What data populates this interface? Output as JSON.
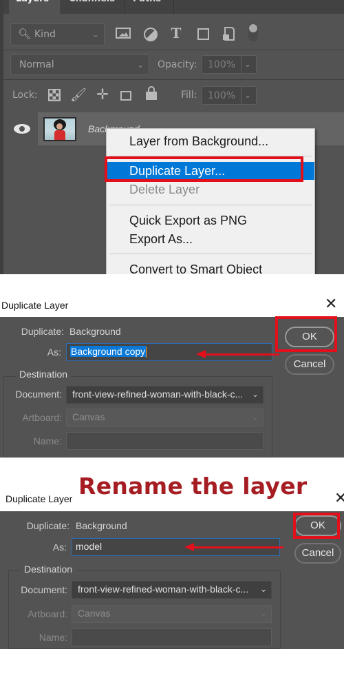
{
  "layers_panel": {
    "tabs": [
      "Layers",
      "Channels",
      "Paths"
    ],
    "filter": {
      "icon": "search-icon",
      "label": "Kind"
    },
    "filter_icons": [
      "image-filter-icon",
      "adjustment-filter-icon",
      "type-filter-icon",
      "shape-filter-icon",
      "smart-object-filter-icon",
      "filter-toggle-icon"
    ],
    "blend_mode": "Normal",
    "opacity_label": "Opacity:",
    "opacity_value": "100%",
    "lock_label": "Lock:",
    "lock_icons": [
      "lock-transparent-pixels-icon",
      "lock-image-pixels-icon",
      "lock-position-icon",
      "lock-artboard-icon",
      "lock-all-icon"
    ],
    "fill_label": "Fill:",
    "fill_value": "100%",
    "layer": {
      "name": "Background",
      "visible": true
    }
  },
  "context_menu": {
    "items": [
      {
        "label": "Layer from Background...",
        "state": "normal"
      },
      {
        "label": "Duplicate Layer...",
        "state": "highlighted"
      },
      {
        "label": "Delete Layer",
        "state": "disabled"
      },
      {
        "label": "Quick Export as PNG",
        "state": "normal"
      },
      {
        "label": "Export As...",
        "state": "normal"
      },
      {
        "label": "Convert to Smart Object",
        "state": "normal"
      }
    ]
  },
  "dialog1": {
    "title": "Duplicate Layer",
    "duplicate_label": "Duplicate:",
    "duplicate_value": "Background",
    "as_label": "As:",
    "as_value": "Background copy",
    "destination_legend": "Destination",
    "document_label": "Document:",
    "document_value": "front-view-refined-woman-with-black-c...",
    "artboard_label": "Artboard:",
    "artboard_value": "Canvas",
    "name_label": "Name:",
    "name_value": "",
    "ok_label": "OK",
    "cancel_label": "Cancel"
  },
  "caption": "Rename the layer",
  "dialog2": {
    "title": "Duplicate Layer",
    "duplicate_label": "Duplicate:",
    "duplicate_value": "Background",
    "as_label": "As:",
    "as_value": "model",
    "destination_legend": "Destination",
    "document_label": "Document:",
    "document_value": "front-view-refined-woman-with-black-c...",
    "artboard_label": "Artboard:",
    "artboard_value": "Canvas",
    "name_label": "Name:",
    "name_value": "",
    "ok_label": "OK",
    "cancel_label": "Cancel"
  },
  "annotation_color": "#e3101b"
}
